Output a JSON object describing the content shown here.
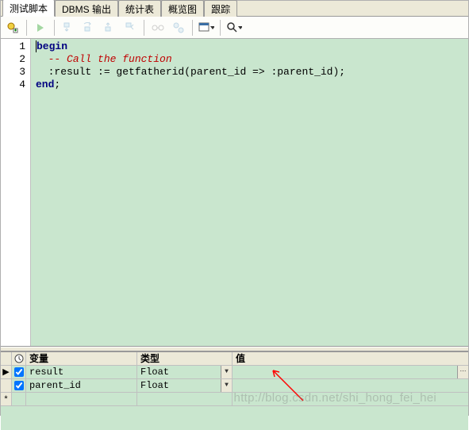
{
  "tabs": {
    "script": "测试脚本",
    "dbms": "DBMS 输出",
    "stats": "统计表",
    "profile": "概览图",
    "trace": "跟踪"
  },
  "code": {
    "line1_kw": "begin",
    "line2_cm": "-- Call the function",
    "line3a": ":result := getfatherid(parent_id => :parent_id);",
    "line4_kw": "end",
    "line4_semi": ";"
  },
  "lines": {
    "l1": "1",
    "l2": "2",
    "l3": "3",
    "l4": "4"
  },
  "grid": {
    "col_var": "变量",
    "col_type": "类型",
    "col_val": "值",
    "rows": [
      {
        "var": "result",
        "type": "Float",
        "value": ""
      },
      {
        "var": "parent_id",
        "type": "Float",
        "value": ""
      }
    ]
  },
  "watermark": "http://blog.csdn.net/shi_hong_fei_hei"
}
